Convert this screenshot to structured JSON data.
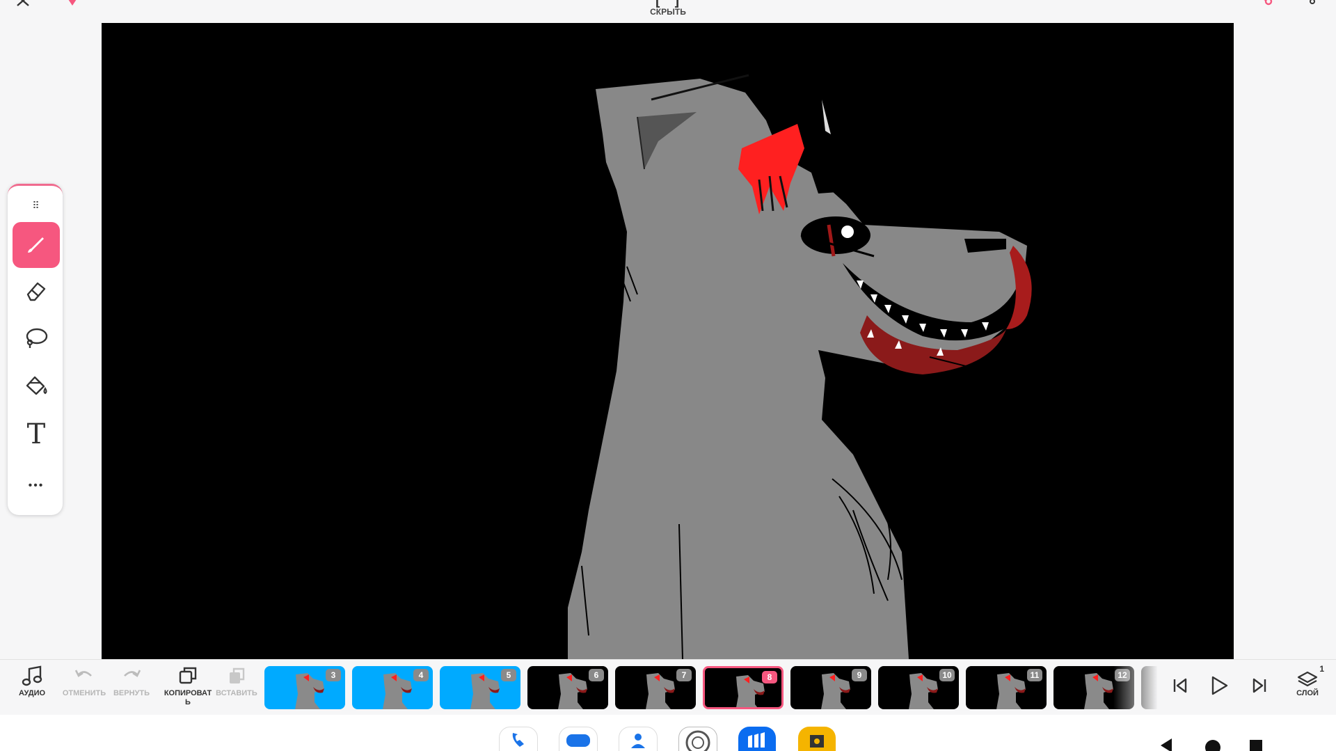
{
  "header": {
    "close_icon": "close-icon",
    "premium_icon": "gem-icon",
    "hide_icon_text": "[ ]",
    "hide_label": "СКРЫТЬ",
    "share_icon": "share-icon",
    "menu_icon": "more-vertical-icon",
    "accent_color": "#f6577f"
  },
  "toolbar": {
    "tools": [
      {
        "name": "brush",
        "icon": "brush-icon",
        "active": true
      },
      {
        "name": "eraser",
        "icon": "eraser-icon",
        "active": false
      },
      {
        "name": "lasso",
        "icon": "lasso-icon",
        "active": false
      },
      {
        "name": "fill",
        "icon": "paint-bucket-icon",
        "active": false
      },
      {
        "name": "text",
        "icon": "text-icon",
        "active": false
      },
      {
        "name": "more",
        "icon": "more-horizontal-icon",
        "active": false
      }
    ],
    "text_tool_glyph": "T",
    "more_glyph": "•••",
    "handle_glyph": "⠿"
  },
  "bottom": {
    "audio_label": "АУДИО",
    "undo_label": "ОТМЕНИТЬ",
    "redo_label": "ВЕРНУТЬ",
    "copy_label": "КОПИРОВАТЬ",
    "paste_label": "ВСТАВИТЬ",
    "layer_label": "СЛОЙ",
    "layer_count": "1",
    "frames": [
      {
        "num": "3",
        "bg": "#00aaff",
        "selected": false
      },
      {
        "num": "4",
        "bg": "#00aaff",
        "selected": false
      },
      {
        "num": "5",
        "bg": "#00aaff",
        "selected": false
      },
      {
        "num": "6",
        "bg": "#000000",
        "selected": false
      },
      {
        "num": "7",
        "bg": "#000000",
        "selected": false
      },
      {
        "num": "8",
        "bg": "#000000",
        "selected": true
      },
      {
        "num": "9",
        "bg": "#000000",
        "selected": false
      },
      {
        "num": "10",
        "bg": "#000000",
        "selected": false
      },
      {
        "num": "11",
        "bg": "#000000",
        "selected": false
      },
      {
        "num": "12",
        "bg": "#000000",
        "selected": false
      },
      {
        "num": "",
        "bg": "#000000",
        "selected": false
      }
    ]
  },
  "playback": {
    "first_icon": "skip-back-icon",
    "play_icon": "play-icon",
    "last_icon": "skip-forward-icon"
  },
  "system": {
    "dock": [
      "phone-app-icon",
      "messages-app-icon",
      "contacts-app-icon",
      "camera-app-icon",
      "store-app-icon",
      "gallery-app-icon"
    ],
    "nav": [
      "back-icon",
      "home-icon",
      "recents-icon"
    ]
  }
}
